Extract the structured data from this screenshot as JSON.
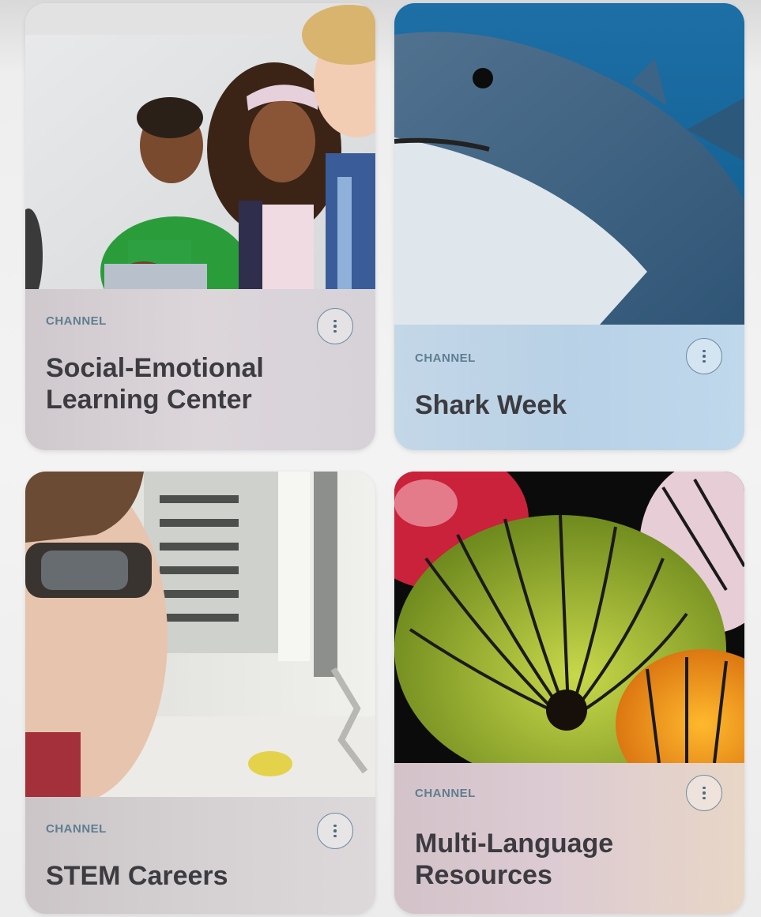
{
  "cards": [
    {
      "kicker": "CHANNEL",
      "title": "Social-Emotional Learning Center",
      "image_icon": "children-photo"
    },
    {
      "kicker": "CHANNEL",
      "title": "Shark Week",
      "image_icon": "shark-photo"
    },
    {
      "kicker": "CHANNEL",
      "title": "STEM Careers",
      "image_icon": "student-lab-photo"
    },
    {
      "kicker": "CHANNEL",
      "title": "Multi-Language Resources",
      "image_icon": "lanterns-photo"
    }
  ],
  "colors": {
    "kicker": "#5f7e90",
    "title": "#3b3b40",
    "button_border": "#6f8ea2"
  }
}
